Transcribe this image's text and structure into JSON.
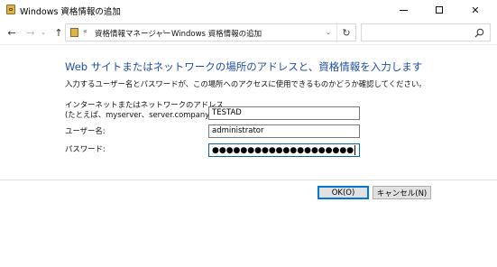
{
  "window": {
    "title": "Windows 資格情報の追加",
    "controls": {
      "minimize": "—",
      "maximize": "☐",
      "close": "✕"
    }
  },
  "nav": {
    "back": "←",
    "forward": "→",
    "dropdown": "⌄",
    "up": "↑",
    "address": {
      "overflow_chevron": "«",
      "crumbs": [
        "資格情報マネージャー",
        "Windows 資格情報の追加"
      ],
      "separator": "›",
      "refresh": "↻"
    },
    "search_placeholder": ""
  },
  "form": {
    "heading": "Web サイトまたはネットワークの場所のアドレスと、資格情報を入力します",
    "description": "入力するユーザー名とパスワードが、この場所へのアクセスに使用できるものかどうか確認してください。",
    "address_label_line1": "インターネットまたはネットワークのアドレス",
    "address_label_line2": "(たとえば、myserver、server.company.com):",
    "address_value": "TESTAD",
    "username_label": "ユーザー名:",
    "username_value": "administrator",
    "password_label": "パスワード:",
    "password_mask": "●●●●●●●●●●●●●●●●●●●●"
  },
  "buttons": {
    "ok": "OK(O)",
    "cancel": "キャンセル(N)"
  },
  "colors": {
    "heading": "#1f4fa5",
    "focus_border": "#0a64ad",
    "default_button_border": "#0078d7"
  },
  "icons": [
    "credential-manager-icon",
    "back-arrow-icon",
    "forward-arrow-icon",
    "up-arrow-icon",
    "refresh-icon",
    "search-icon"
  ]
}
